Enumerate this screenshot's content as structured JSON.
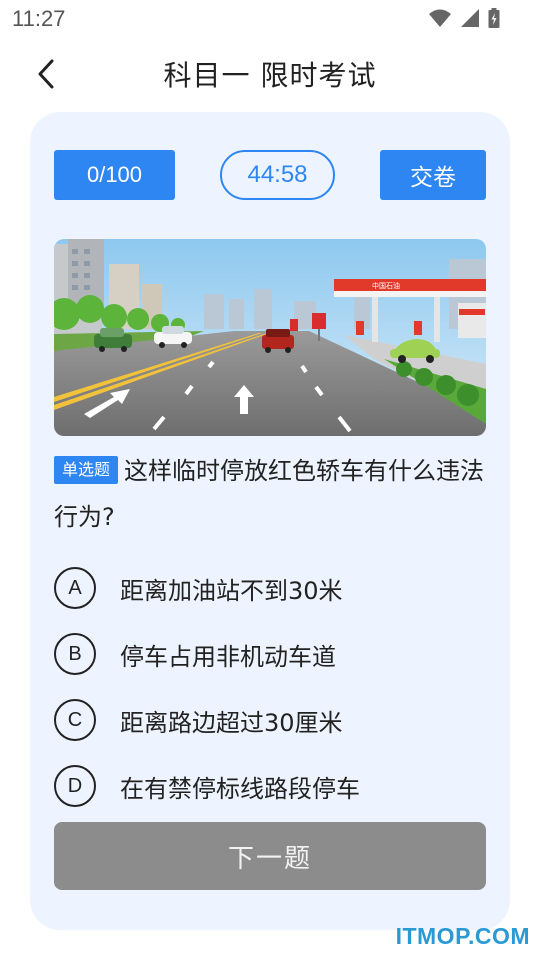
{
  "status_bar": {
    "time": "11:27"
  },
  "header": {
    "title": "科目一 限时考试"
  },
  "exam": {
    "progress": "0/100",
    "timer": "44:58",
    "submit_label": "交卷"
  },
  "scene": {
    "station_sign": "中国石油"
  },
  "question": {
    "type_tag": "单选题",
    "text": "这样临时停放红色轿车有什么违法行为?"
  },
  "options": [
    {
      "letter": "A",
      "text": "距离加油站不到30米"
    },
    {
      "letter": "B",
      "text": "停车占用非机动车道"
    },
    {
      "letter": "C",
      "text": "距离路边超过30厘米"
    },
    {
      "letter": "D",
      "text": "在有禁停标线路段停车"
    }
  ],
  "next_label": "下一题",
  "watermark": "ITMOP.COM",
  "colors": {
    "accent": "#2e86f2",
    "card_bg": "#eef4ff",
    "disabled": "#8c8c8c"
  }
}
